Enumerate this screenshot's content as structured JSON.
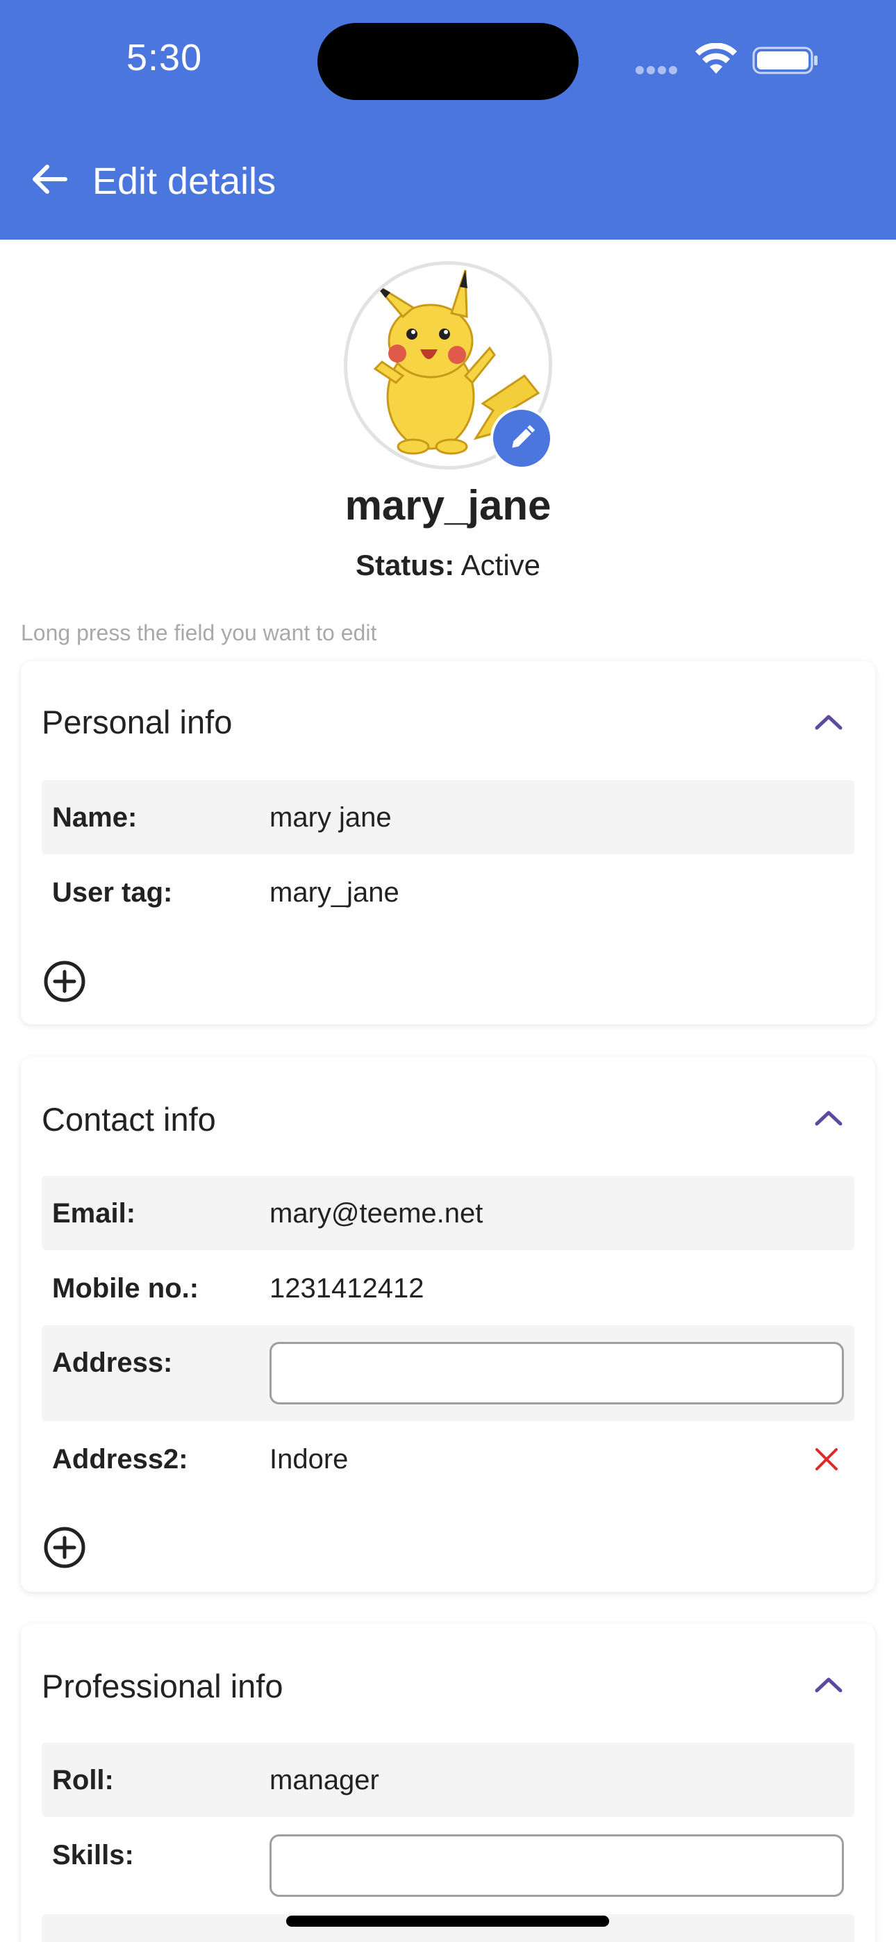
{
  "status_bar": {
    "time": "5:30"
  },
  "header": {
    "title": "Edit details"
  },
  "profile": {
    "username": "mary_jane",
    "status_label": "Status:",
    "status_value": "Active",
    "hint": "Long press the field you want to edit"
  },
  "sections": {
    "personal": {
      "title": "Personal info",
      "rows": [
        {
          "label": "Name:",
          "value": "mary jane"
        },
        {
          "label": "User tag:",
          "value": "mary_jane"
        }
      ]
    },
    "contact": {
      "title": "Contact info",
      "rows": [
        {
          "label": "Email:",
          "value": "mary@teeme.net"
        },
        {
          "label": "Mobile no.:",
          "value": "1231412412"
        },
        {
          "label": "Address:",
          "value": ""
        },
        {
          "label": "Address2:",
          "value": "Indore"
        }
      ]
    },
    "professional": {
      "title": "Professional info",
      "rows": [
        {
          "label": "Roll:",
          "value": "manager"
        },
        {
          "label": "Skills:",
          "value": ""
        }
      ]
    }
  },
  "colors": {
    "header_bg": "#4a76dd",
    "accent_chevron": "#5b4aa0",
    "delete_red": "#e02a2a",
    "row_shade": "#f4f4f4"
  },
  "icons": {
    "back": "arrow-left-icon",
    "edit": "pencil-icon",
    "collapse": "chevron-up-icon",
    "add": "plus-circle-icon",
    "delete": "close-icon"
  }
}
